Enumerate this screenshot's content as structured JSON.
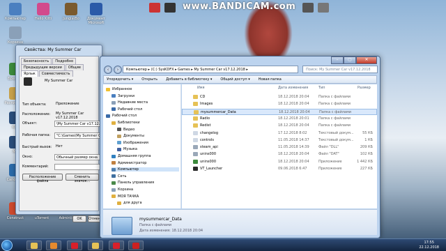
{
  "watermark": "www.BANDICAM.com",
  "desktop": {
    "icons": [
      {
        "label": "Компьютер",
        "color": "#4a7fc0"
      },
      {
        "label": "Hello Kitti",
        "color": "#d24a8c"
      },
      {
        "label": "Jungla\\Bo",
        "color": "#7a5a2e"
      },
      {
        "label": "Документ Microsoft",
        "color": "#2b5aa8"
      },
      {
        "label": "Корзина",
        "color": "#8aa0b8"
      },
      {
        "label": "Браузер",
        "color": "#3c8a3c"
      },
      {
        "label": "Расписание",
        "color": "#c6a04a"
      },
      {
        "label": "Кор",
        "color": "#2b4d7a"
      },
      {
        "label": "Mu",
        "color": "#2b4d7a"
      },
      {
        "label": "Canon MP",
        "color": "#2b6aa8"
      },
      {
        "label": "Construct",
        "color": "#cc4a2e"
      },
      {
        "label": "uTorrent",
        "color": "#4aa83c"
      },
      {
        "label": "Admin\\ista",
        "color": "#2b4d7a"
      }
    ]
  },
  "properties_window": {
    "title": "Свойства: My Summer Car",
    "tabs": [
      "Безопасность",
      "Подробно",
      "Предыдущие версии",
      "Общие",
      "Ярлык",
      "Совместимость"
    ],
    "app_name": "My Summer Car",
    "rows": [
      {
        "label": "Тип объекта:",
        "value": "Приложение"
      },
      {
        "label": "Расположение:",
        "value": "My Summer Car v17.12.2018"
      },
      {
        "label": "Объект:",
        "value": "\\My Summer Car v17.12.2018"
      },
      {
        "label": "Рабочая папка:",
        "value": "\"C:\\Games\\My Summer Car v"
      },
      {
        "label": "Быстрый вызов:",
        "value": "Нет"
      },
      {
        "label": "Окно:",
        "value": "Обычный размер окна"
      },
      {
        "label": "Комментарий:",
        "value": ""
      }
    ],
    "btn_location": "Расположение файла",
    "btn_icon": "Сменить значок...",
    "btn_ok": "OK",
    "btn_cancel": "Отмена"
  },
  "explorer": {
    "address": "Компьютер ▸ (C:) SysKDFX ▸ Games ▸ My Summer Car v17.12.2018 ▸",
    "search_placeholder": "Поиск: My Summer Car v17.12.2018",
    "toolbar": [
      "Упорядочить ▾",
      "Открыть",
      "Добавить в библиотеку ▾",
      "Общий доступ ▾",
      "Новая папка"
    ],
    "nav": [
      {
        "label": "Избранное",
        "indent": 0,
        "color": "#f0c030"
      },
      {
        "label": "Загрузки",
        "indent": 1,
        "color": "#4a7fc0"
      },
      {
        "label": "Недавние места",
        "indent": 1,
        "color": "#8aa0b8"
      },
      {
        "label": "Рабочий стол",
        "indent": 1,
        "color": "#3a6aa8"
      },
      {
        "label": "Рабочий стол",
        "indent": 0,
        "color": "#3a6aa8"
      },
      {
        "label": "Библиотеки",
        "indent": 1,
        "color": "#e0b040"
      },
      {
        "label": "Видео",
        "indent": 2,
        "color": "#555"
      },
      {
        "label": "Документы",
        "indent": 2,
        "color": "#c0a060"
      },
      {
        "label": "Изображения",
        "indent": 2,
        "color": "#60a0d0"
      },
      {
        "label": "Музыка",
        "indent": 2,
        "color": "#4060a0"
      },
      {
        "label": "Домашняя группа",
        "indent": 1,
        "color": "#3080c0"
      },
      {
        "label": "Администратор",
        "indent": 1,
        "color": "#c08040"
      },
      {
        "label": "Компьютер",
        "indent": 1,
        "color": "#5080b0",
        "selected": true
      },
      {
        "label": "Сеть",
        "indent": 1,
        "color": "#4070a0"
      },
      {
        "label": "Панель управления",
        "indent": 1,
        "color": "#4a8a4a"
      },
      {
        "label": "Корзина",
        "indent": 1,
        "color": "#8aa0b8"
      },
      {
        "label": "МОЯ ТАЧКА",
        "indent": 1,
        "color": "#e0b040"
      },
      {
        "label": "для друга",
        "indent": 2,
        "color": "#e0b040"
      }
    ],
    "columns": [
      "Имя",
      "Дата изменения",
      "Тип",
      "Размер"
    ],
    "files": [
      {
        "name": "CD",
        "date": "18.12.2018 20:04",
        "type": "Папка с файлами",
        "size": "",
        "color": "#e6c256"
      },
      {
        "name": "Images",
        "date": "18.12.2018 20:04",
        "type": "Папка с файлами",
        "size": "",
        "color": "#e6c256"
      },
      {
        "name": "mysummercar_Data",
        "date": "18.12.2018 20:04",
        "type": "Папка с файлами",
        "size": "",
        "color": "#e6c256",
        "selected": true
      },
      {
        "name": "Radio",
        "date": "18.12.2018 20:01",
        "type": "Папка с файлами",
        "size": "",
        "color": "#e6c256"
      },
      {
        "name": "Redist",
        "date": "18.12.2018 20:04",
        "type": "Папка с файлами",
        "size": "",
        "color": "#e6c256"
      },
      {
        "name": "changelog",
        "date": "17.12.2018 8:02",
        "type": "Текстовый докум...",
        "size": "55 КБ",
        "color": "#cfd8e4"
      },
      {
        "name": "controls",
        "date": "11.05.2018 14:37",
        "type": "Текстовый докум...",
        "size": "1 КБ",
        "color": "#cfd8e4"
      },
      {
        "name": "steam_api",
        "date": "11.05.2018 14:39",
        "type": "Файл \"DLL\"",
        "size": "209 КБ",
        "color": "#9aa8b8"
      },
      {
        "name": "unins000",
        "date": "18.12.2018 20:04",
        "type": "Файл \"DAT\"",
        "size": "102 КБ",
        "color": "#9aa8b8"
      },
      {
        "name": "unins000",
        "date": "18.12.2018 20:04",
        "type": "Приложение",
        "size": "1 442 КБ",
        "color": "#3c8a3c"
      },
      {
        "name": "VT_Launcher",
        "date": "09.06.2018 6:47",
        "type": "Приложение",
        "size": "227 КБ",
        "color": "#2a2a2a"
      }
    ],
    "details": {
      "name": "mysummercar_Data",
      "type": "Папка с файлами",
      "modified": "Дата изменения: 18.12.2018 20:04"
    }
  },
  "taskbar": {
    "items": [
      {
        "name": "explorer",
        "color": "#e6c256"
      },
      {
        "name": "wmp",
        "color": "#e68a2e"
      },
      {
        "name": "opera",
        "color": "#d8202a"
      },
      {
        "name": "folder2",
        "color": "#e6c256"
      },
      {
        "name": "opera2",
        "color": "#d8202a"
      },
      {
        "name": "bandicam",
        "color": "#cc2020"
      }
    ],
    "time": "17:55",
    "date": "22.12.2018"
  }
}
